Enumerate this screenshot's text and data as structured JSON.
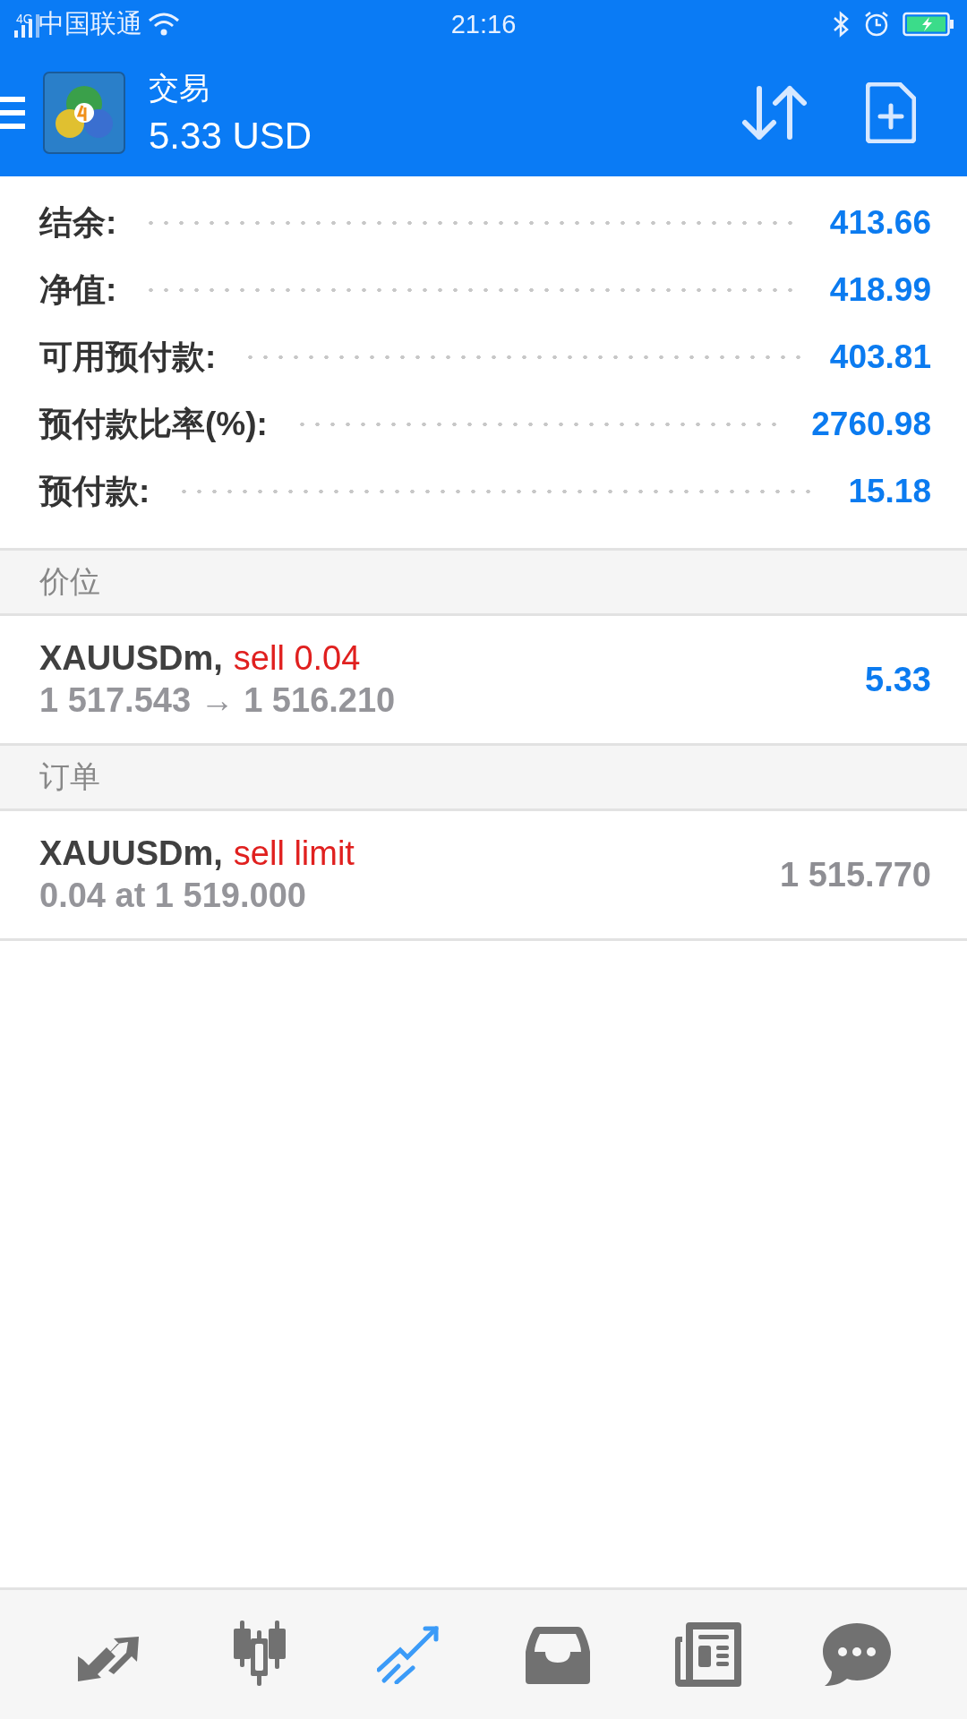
{
  "status_bar": {
    "network": "4G",
    "carrier": "中国联通",
    "time": "21:16"
  },
  "header": {
    "title": "交易",
    "balance": "5.33 USD"
  },
  "summary": [
    {
      "label": "结余:",
      "value": "413.66"
    },
    {
      "label": "净值:",
      "value": "418.99"
    },
    {
      "label": "可用预付款:",
      "value": "403.81"
    },
    {
      "label": "预付款比率(%):",
      "value": "2760.98"
    },
    {
      "label": "预付款:",
      "value": "15.18"
    }
  ],
  "sections": [
    {
      "title": "价位",
      "items": [
        {
          "kind": "position",
          "symbol": "XAUUSDm,",
          "type": "sell 0.04",
          "detail": "1 517.543 → 1 516.210",
          "value": "5.33"
        }
      ]
    },
    {
      "title": "订单",
      "items": [
        {
          "kind": "order",
          "symbol": "XAUUSDm,",
          "type": "sell limit",
          "detail": "0.04 at 1 519.000",
          "value": "1 515.770"
        }
      ]
    }
  ],
  "bottom_nav": [
    {
      "selected": false
    },
    {
      "selected": false
    },
    {
      "selected": true
    },
    {
      "selected": false
    },
    {
      "selected": false
    },
    {
      "selected": false
    }
  ]
}
